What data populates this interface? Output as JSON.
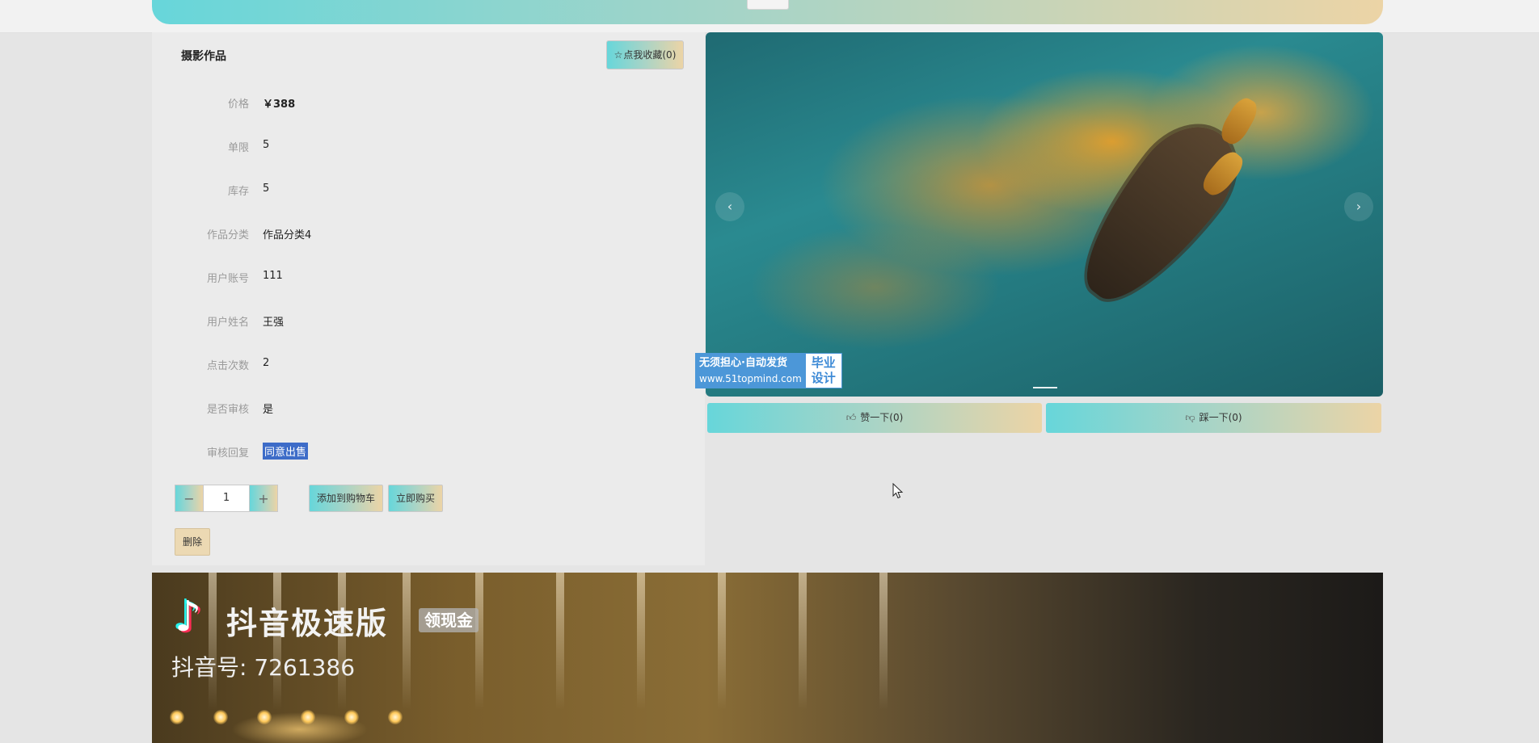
{
  "colors": {
    "accent_start": "#67d6da",
    "accent_end": "#ecd4a6",
    "highlight": "#3d6cc8",
    "label": "#9a9a9a"
  },
  "product": {
    "title": "摄影作品",
    "favorite_button": "点我收藏(0)",
    "favorite_icon": "star-outline-icon",
    "fields": [
      {
        "label": "价格",
        "value": "￥388"
      },
      {
        "label": "单限",
        "value": "5"
      },
      {
        "label": "库存",
        "value": "5"
      },
      {
        "label": "作品分类",
        "value": "作品分类4"
      },
      {
        "label": "用户账号",
        "value": "111"
      },
      {
        "label": "用户姓名",
        "value": "王强"
      },
      {
        "label": "点击次数",
        "value": "2"
      },
      {
        "label": "是否审核",
        "value": "是"
      },
      {
        "label": "审核回复",
        "value": "同意出售"
      }
    ],
    "quantity": {
      "minus": "−",
      "value": "1",
      "plus": "+"
    },
    "add_to_cart": "添加到购物车",
    "buy_now": "立即购买",
    "delete": "删除"
  },
  "carousel": {
    "prev_icon": "chevron-left-icon",
    "next_icon": "chevron-right-icon",
    "prev": "‹",
    "next": "›"
  },
  "watermark": {
    "line1": "无须担心·自动发货",
    "line2": "www.51topmind.com",
    "badge_top": "毕业",
    "badge_bottom": "设计"
  },
  "votes": {
    "like": "赞一下(0)",
    "dislike": "踩一下(0)",
    "like_icon": "thumbs-up-icon",
    "dislike_icon": "thumbs-down-icon"
  },
  "video": {
    "app_name": "抖音极速版",
    "badge": "领现金",
    "account": "抖音号: 7261386"
  }
}
